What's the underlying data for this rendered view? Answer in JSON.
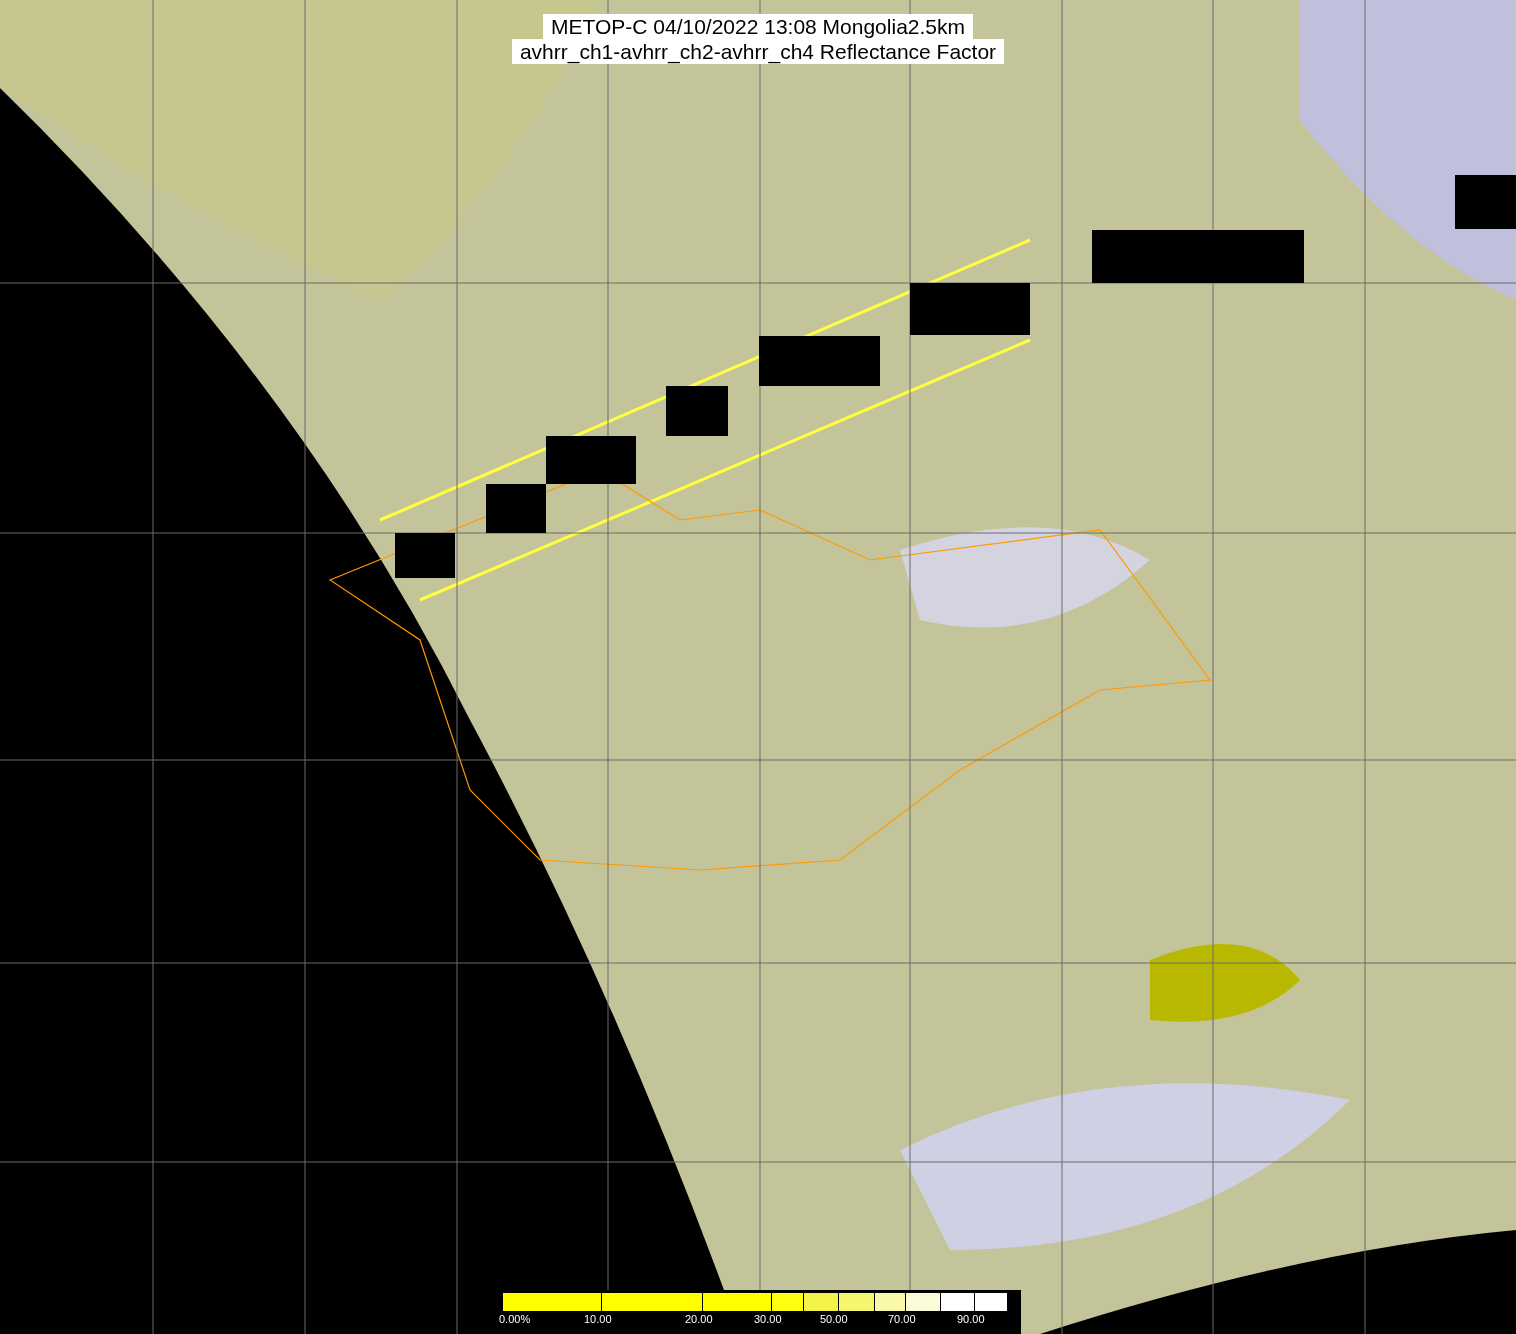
{
  "title": {
    "lines": [
      "METOP-C 04/10/2022 13:08 Mongolia2.5km",
      "avhrr_ch1-avhrr_ch2-avhrr_ch4 Reflectance Factor"
    ]
  },
  "colorbar": {
    "labels": [
      "0.00%",
      "10.00",
      "20.00",
      "30.00",
      "50.00",
      "70.00",
      "90.00"
    ]
  }
}
